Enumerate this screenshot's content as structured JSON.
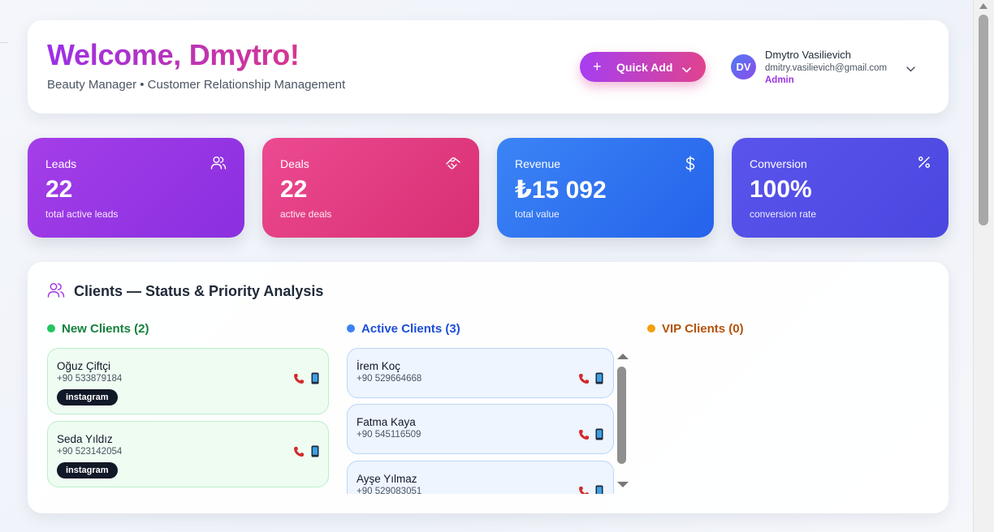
{
  "header": {
    "welcome": "Welcome, Dmytro!",
    "subtitle": "Beauty Manager • Customer Relationship Management",
    "quick_add": {
      "label": "Quick Add",
      "icon": "plus-icon"
    }
  },
  "user": {
    "initials": "DV",
    "name": "Dmytro Vasilievich",
    "email": "dmitry.vasilievich@gmail.com",
    "role": "Admin"
  },
  "stats": [
    {
      "label": "Leads",
      "value": "22",
      "sub": "total active leads",
      "icon": "users-icon",
      "color": "#9b35e5"
    },
    {
      "label": "Deals",
      "value": "22",
      "sub": "active deals",
      "icon": "handshake-icon",
      "color": "#e23c82"
    },
    {
      "label": "Revenue",
      "value": "₺15 092",
      "sub": "total value",
      "icon": "dollar-icon",
      "color": "#2f74f0"
    },
    {
      "label": "Conversion",
      "value": "100%",
      "sub": "conversion rate",
      "icon": "percent-icon",
      "color": "#524ee6"
    }
  ],
  "clients": {
    "title": "Clients — Status & Priority Analysis",
    "columns": {
      "new": {
        "label": "New Clients (2)",
        "color": "#22c55e"
      },
      "active": {
        "label": "Active Clients (3)",
        "color": "#3b82f6"
      },
      "vip": {
        "label": "VIP Clients (0)",
        "color": "#f59e0b"
      }
    },
    "new_clients": [
      {
        "name": "Oğuz Çiftçi",
        "phone": "+90 533879184",
        "tag": "instagram"
      },
      {
        "name": "Seda Yıldız",
        "phone": "+90 523142054",
        "tag": "instagram"
      }
    ],
    "active_clients": [
      {
        "name": "İrem Koç",
        "phone": "+90 529664668"
      },
      {
        "name": "Fatma Kaya",
        "phone": "+90 545116509"
      },
      {
        "name": "Ayşe Yılmaz",
        "phone": "+90 529083051"
      }
    ]
  }
}
